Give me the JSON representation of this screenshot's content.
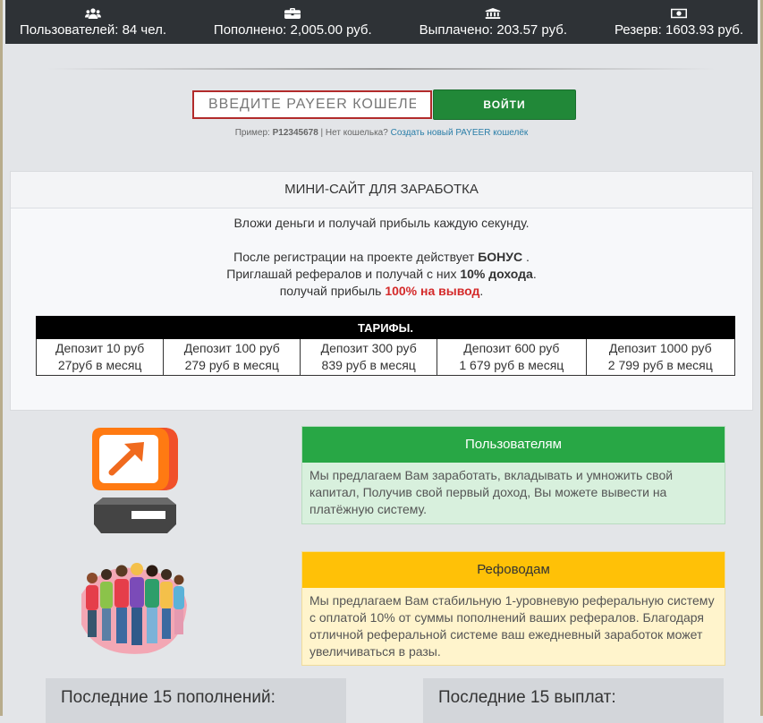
{
  "stats": [
    {
      "icon": "users-icon",
      "text": "Пользователей: 84 чел."
    },
    {
      "icon": "briefcase-icon",
      "text": "Пополнено: 2,005.00 руб."
    },
    {
      "icon": "bank-icon",
      "text": "Выплачено: 203.57 руб."
    },
    {
      "icon": "money-icon",
      "text": "Резерв: 1603.93 руб."
    }
  ],
  "login": {
    "placeholder": "ВВЕДИТЕ PAYEER КОШЕЛЕК",
    "button": "ВОЙТИ",
    "hint_prefix": "Пример: ",
    "hint_example": "P12345678",
    "hint_middle": " | Нет кошелька? ",
    "hint_link": "Создать новый PAYEER кошелёк"
  },
  "panel": {
    "title": "МИНИ-САЙТ ДЛЯ ЗАРАБОТКА",
    "line1": "Вложи деньги и получай прибыль каждую секунду.",
    "line2a": "После регистрации на проекте действует ",
    "line2b": "БОНУС",
    "line2c": " .",
    "line3a": "Приглашай рефералов и получай с них ",
    "line3b": "10% дохода",
    "line3c": ".",
    "line4a": "получай прибыль ",
    "line4b": "100% на вывод",
    "line4c": "."
  },
  "tariffs": {
    "title": "ТАРИФЫ.",
    "items": [
      {
        "deposit": "Депозит 10 руб",
        "profit": "27руб в месяц"
      },
      {
        "deposit": "Депозит 100 руб",
        "profit": "279 руб в месяц"
      },
      {
        "deposit": "Депозит 300 руб",
        "profit": "839 руб в месяц"
      },
      {
        "deposit": "Депозит 600 руб",
        "profit": "1 679 руб в месяц"
      },
      {
        "deposit": "Депозит 1000 руб",
        "profit": "2 799 руб в месяц"
      }
    ]
  },
  "users_card": {
    "title": "Пользователям",
    "text": "Мы предлагаем Вам заработать, вкладывать и умножить свой капитал, Получив свой первый доход, Вы можете вывести на платёжную систему."
  },
  "refs_card": {
    "title": "Рефоводам",
    "text": "Мы предлагаем Вам стабильную 1-уровневую реферальную систему с оплатой 10% от суммы пополнений ваших рефералов. Благодаря отличной реферальной системе ваш ежедневный заработок может увеличиваться в разы."
  },
  "last": {
    "deposits": "Последние 15 пополнений:",
    "payouts": "Последние 15 выплат:"
  }
}
